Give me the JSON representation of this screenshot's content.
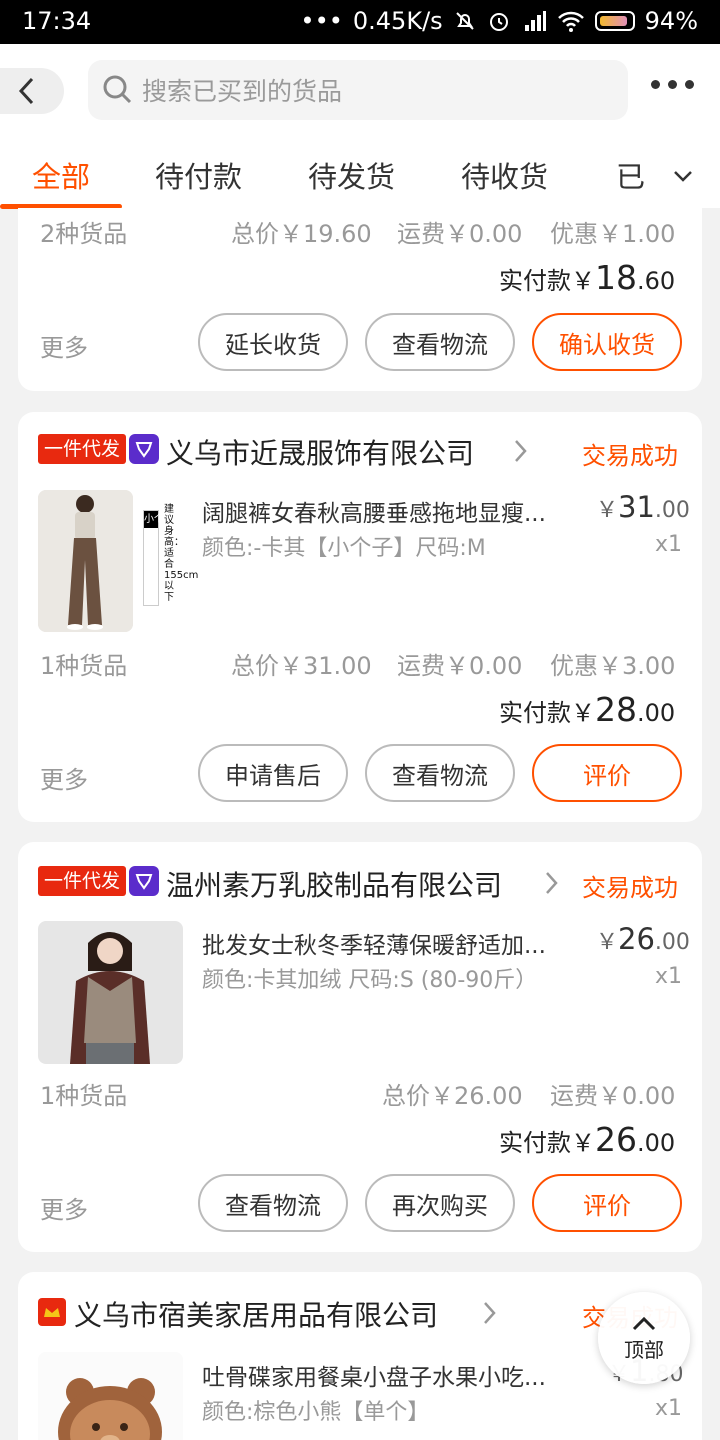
{
  "status_bar": {
    "time": "17:34",
    "dots": "•••",
    "network_speed": "0.45K/s",
    "battery": "94%"
  },
  "header": {
    "search_placeholder": "搜索已买到的货品",
    "tabs": [
      "全部",
      "待付款",
      "待发货",
      "待收货",
      "已"
    ],
    "active_tab": 0
  },
  "colors": {
    "accent": "#ff5000",
    "tag_red": "#e8290f",
    "badge_purple": "#5b2ccb"
  },
  "order1": {
    "item_count": "2种货品",
    "total": "总价￥19.60",
    "shipping": "运费￥0.00",
    "discount": "优惠￥1.00",
    "paid_label": "实付款￥",
    "paid_int": "18",
    "paid_dec": ".60",
    "more": "更多",
    "buttons": [
      "延长收货",
      "查看物流",
      "确认收货"
    ]
  },
  "order2": {
    "tag": "一件代发",
    "shop": "义乌市近晟服饰有限公司",
    "status": "交易成功",
    "item_title": "阔腿裤女春秋高腰垂感拖地显瘦...",
    "item_spec": "颜色:-卡其【小个子】尺码:M",
    "price_sym": "￥",
    "price_int": "31",
    "price_dec": ".00",
    "qty": "x1",
    "image_text_1": "小个子",
    "image_text_2": "建议身高：适合155cm以下",
    "item_count": "1种货品",
    "total": "总价￥31.00",
    "shipping": "运费￥0.00",
    "discount": "优惠￥3.00",
    "paid_label": "实付款￥",
    "paid_int": "28",
    "paid_dec": ".00",
    "more": "更多",
    "buttons": [
      "申请售后",
      "查看物流",
      "评价"
    ]
  },
  "order3": {
    "tag": "一件代发",
    "shop": "温州素万乳胶制品有限公司",
    "status": "交易成功",
    "item_title": "批发女士秋冬季轻薄保暖舒适加...",
    "item_spec": "颜色:卡其加绒 尺码:S (80-90斤）",
    "price_sym": "￥",
    "price_int": "26",
    "price_dec": ".00",
    "qty": "x1",
    "item_count": "1种货品",
    "total": "总价￥26.00",
    "shipping": "运费￥0.00",
    "paid_label": "实付款￥",
    "paid_int": "26",
    "paid_dec": ".00",
    "more": "更多",
    "buttons": [
      "查看物流",
      "再次购买",
      "评价"
    ]
  },
  "order4": {
    "shop": "义乌市宿美家居用品有限公司",
    "status": "交易成功",
    "item_title": "吐骨碟家用餐桌小盘子水果小吃...",
    "item_spec": "颜色:棕色小熊【单个】",
    "price_sym": "￥",
    "price_int": "1",
    "price_dec": ".80",
    "qty": "x1"
  },
  "back_to_top": {
    "label": "顶部"
  }
}
